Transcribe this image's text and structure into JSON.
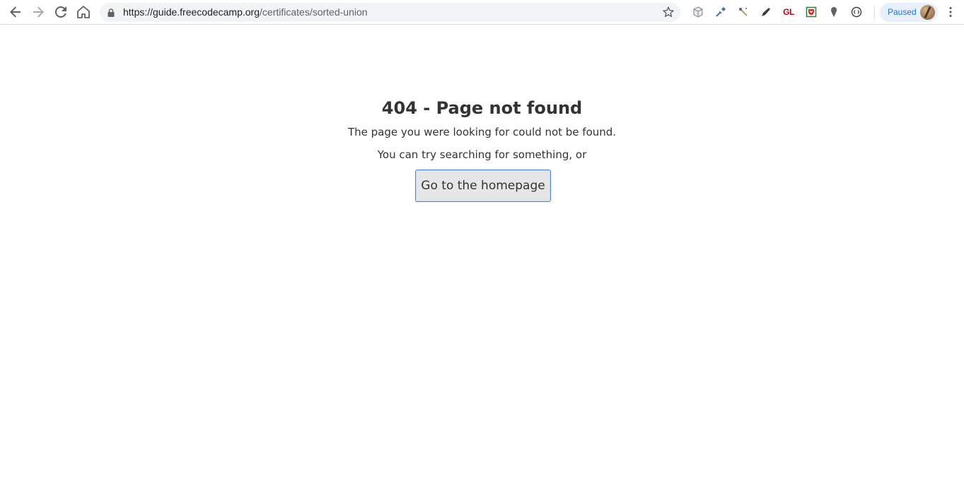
{
  "browser": {
    "url_host": "https://guide.freecodecamp.org",
    "url_path": "/certificates/sorted-union",
    "extensions": [
      "cube-icon",
      "pipette-icon",
      "wand-icon",
      "pen-icon",
      "gl-extension",
      "pocket-icon",
      "pin-icon",
      "shield-icon"
    ],
    "gl_label": "GL",
    "profile_status": "Paused"
  },
  "page": {
    "title": "404 - Page not found",
    "message": "The page you were looking for could not be found.",
    "suggestion": "You can try searching for something, or",
    "home_button_label": "Go to the homepage"
  },
  "colors": {
    "accent": "#4a86e8",
    "text": "#333333",
    "button_bg": "#e6e6e6",
    "gl_red": "#b3001b"
  }
}
